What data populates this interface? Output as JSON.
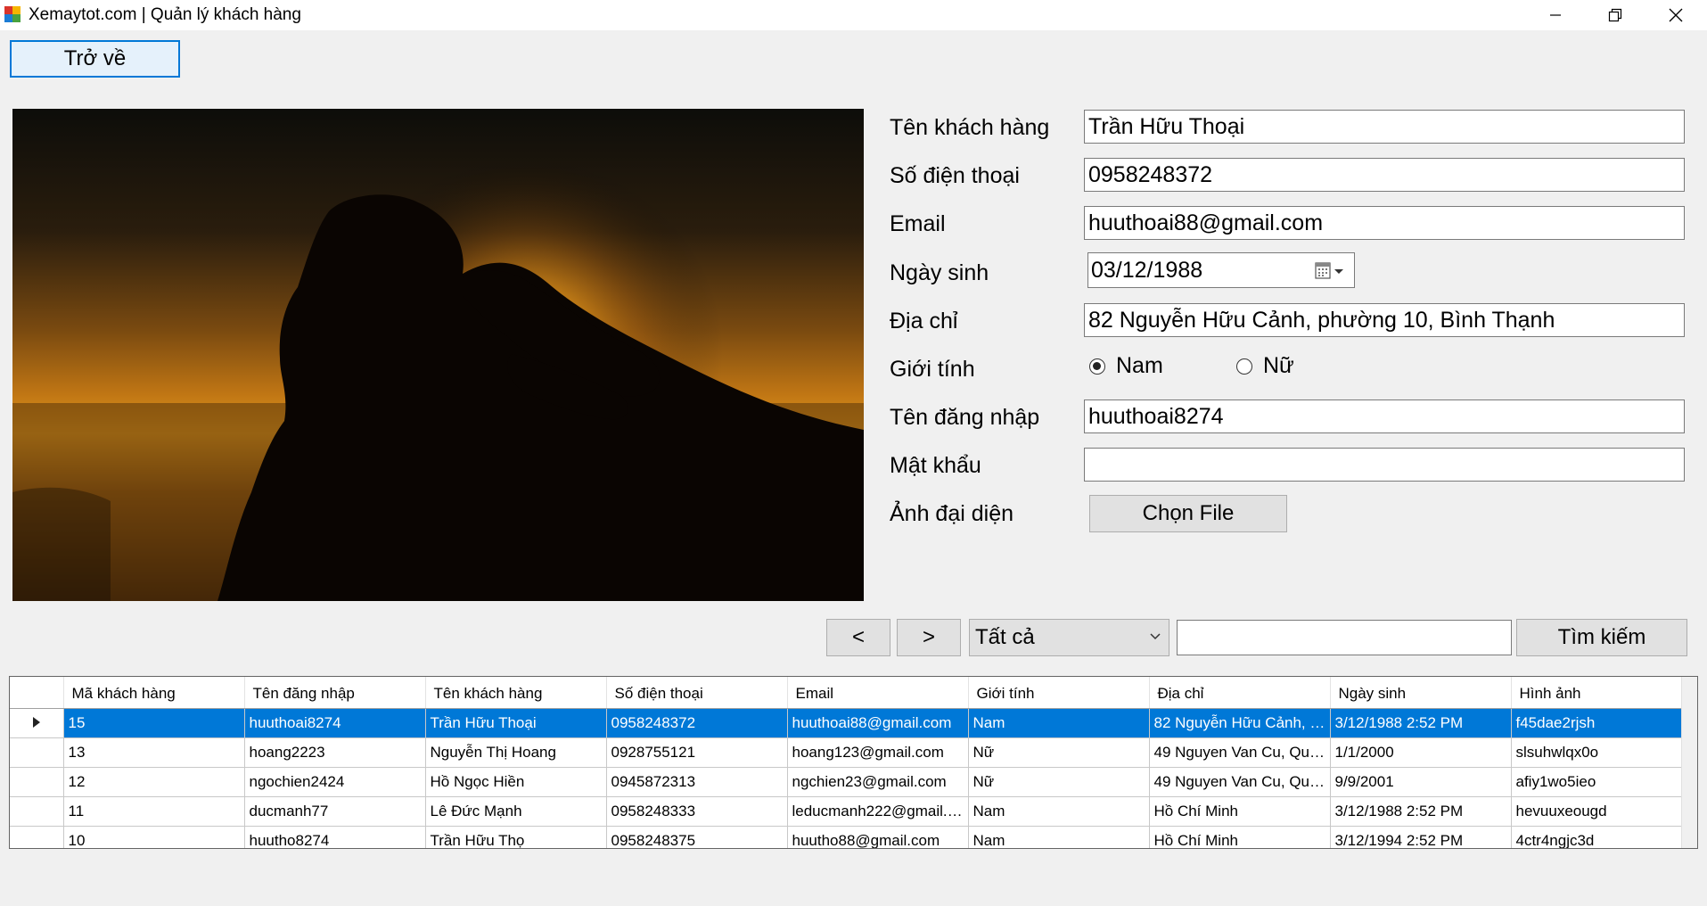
{
  "window": {
    "title": "Xemaytot.com | Quản lý khách hàng"
  },
  "toolbar": {
    "back_label": "Trở về"
  },
  "form": {
    "name_label": "Tên khách hàng",
    "name_value": "Trần Hữu Thoại",
    "phone_label": "Số điện thoại",
    "phone_value": "0958248372",
    "email_label": "Email",
    "email_value": "huuthoai88@gmail.com",
    "dob_label": "Ngày sinh",
    "dob_value": "03/12/1988",
    "address_label": "Địa chỉ",
    "address_value": "82 Nguyễn Hữu Cảnh, phường 10, Bình Thạnh",
    "gender_label": "Giới tính",
    "gender_male": "Nam",
    "gender_female": "Nữ",
    "gender_selected": "Nam",
    "username_label": "Tên đăng nhập",
    "username_value": "huuthoai8274",
    "password_label": "Mật khẩu",
    "password_value": "",
    "avatar_label": "Ảnh đại diện",
    "choose_file_label": "Chọn File"
  },
  "search": {
    "prev_label": "<",
    "next_label": ">",
    "filter_value": "Tất cả",
    "query": "",
    "search_label": "Tìm kiếm"
  },
  "grid": {
    "columns": [
      "Mã khách hàng",
      "Tên đăng nhập",
      "Tên khách hàng",
      "Số điện thoại",
      "Email",
      "Giới tính",
      "Địa chỉ",
      "Ngày sinh",
      "Hình ảnh"
    ],
    "rows": [
      [
        "15",
        "huuthoai8274",
        "Trần Hữu Thoại",
        "0958248372",
        "huuthoai88@gmail.com",
        "Nam",
        "82 Nguyễn Hữu Cảnh, p...",
        "3/12/1988 2:52 PM",
        "f45dae2rjsh"
      ],
      [
        "13",
        "hoang2223",
        "Nguyễn Thị Hoang",
        "0928755121",
        "hoang123@gmail.com",
        "Nữ",
        "49 Nguyen Van Cu, Qua...",
        "1/1/2000",
        "slsuhwlqx0o"
      ],
      [
        "12",
        "ngochien2424",
        "Hồ Ngọc Hiền",
        "0945872313",
        "ngchien23@gmail.com",
        "Nữ",
        "49 Nguyen Van Cu, Qua...",
        "9/9/2001",
        "afiy1wo5ieo"
      ],
      [
        "11",
        "ducmanh77",
        "Lê Đức Mạnh",
        "0958248333",
        "leducmanh222@gmail.com",
        "Nam",
        "Hồ Chí Minh",
        "3/12/1988 2:52 PM",
        "hevuuxeougd"
      ],
      [
        "10",
        "huutho8274",
        "Trần Hữu Thọ",
        "0958248375",
        "huutho88@gmail.com",
        "Nam",
        "Hồ Chí Minh",
        "3/12/1994 2:52 PM",
        "4ctr4ngjc3d"
      ]
    ],
    "selected_row": 0
  },
  "colors": {
    "selection": "#0078d7",
    "accent_border": "#0078d7",
    "background": "#f0f0f0"
  },
  "icons": [
    "app-icon",
    "minimize-icon",
    "restore-icon",
    "close-icon",
    "calendar-icon",
    "chevron-down-icon",
    "row-pointer-icon"
  ]
}
